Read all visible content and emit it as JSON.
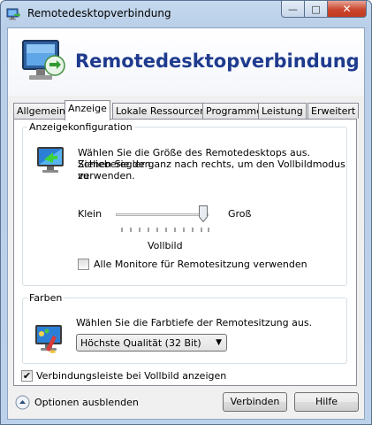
{
  "window": {
    "title": "Remotedesktopverbindung"
  },
  "banner": {
    "title": "Remotedesktopverbindung"
  },
  "tabs": [
    {
      "label": "Allgemein",
      "active": false
    },
    {
      "label": "Anzeige",
      "active": true
    },
    {
      "label": "Lokale Ressourcen",
      "active": false
    },
    {
      "label": "Programme",
      "active": false
    },
    {
      "label": "Leistung",
      "active": false
    },
    {
      "label": "Erweitert",
      "active": false
    }
  ],
  "display": {
    "legend": "Anzeigekonfiguration",
    "line1": "Wählen Sie die Größe des Remotedesktops aus. Ziehen Sie den",
    "line2": "Schieberegler ganz nach rechts, um den Vollbildmodus zu",
    "line3": "verwenden.",
    "slider_min": "Klein",
    "slider_max": "Groß",
    "slider_value": "Vollbild",
    "slider_level": 1.0,
    "all_monitors_label": "Alle Monitore für Remotesitzung verwenden",
    "all_monitors_checked": false
  },
  "colors": {
    "legend": "Farben",
    "description": "Wählen Sie die Farbtiefe der Remotesitzung aus.",
    "selected": "Höchste Qualität (32 Bit)"
  },
  "connection_bar": {
    "label": "Verbindungsleiste bei Vollbild anzeigen",
    "checked": true
  },
  "footer": {
    "options_label": "Optionen ausblenden",
    "connect": "Verbinden",
    "help": "Hilfe"
  },
  "theme": {
    "accent": "#1f3b8e",
    "close_button": "#c9462d"
  }
}
